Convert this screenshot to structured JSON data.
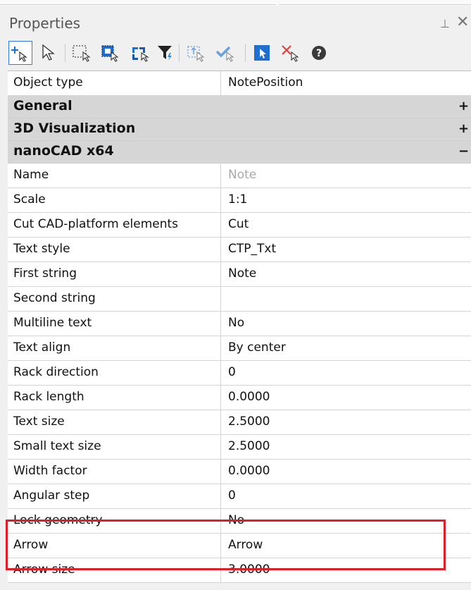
{
  "panel": {
    "title": "Properties",
    "pin_glyph": "⊥",
    "close_glyph": "✕"
  },
  "toolbar": {
    "icons": [
      "add-selection-icon",
      "select-cursor-icon",
      "window-select-icon",
      "quick-select-icon",
      "invert-select-icon",
      "filter-icon",
      "export-select-icon",
      "confirm-select-icon",
      "pick-object-icon",
      "deselect-icon",
      "help-icon"
    ]
  },
  "grid": {
    "object_type": {
      "name": "Object type",
      "value": "NotePosition"
    },
    "sections": [
      {
        "name": "General",
        "sign": "+"
      },
      {
        "name": "3D Visualization",
        "sign": "+"
      },
      {
        "name": "nanoCAD x64",
        "sign": "−"
      }
    ],
    "properties": [
      {
        "name": "Name",
        "value": "Note"
      },
      {
        "name": "Scale",
        "value": "1:1"
      },
      {
        "name": "Cut CAD-platform elements",
        "value": "Cut"
      },
      {
        "name": "Text style",
        "value": "CTP_Txt"
      },
      {
        "name": "First string",
        "value": "Note"
      },
      {
        "name": "Second string",
        "value": ""
      },
      {
        "name": "Multiline text",
        "value": "No"
      },
      {
        "name": "Text align",
        "value": "By center"
      },
      {
        "name": "Rack direction",
        "value": "0"
      },
      {
        "name": "Rack length",
        "value": "0.0000"
      },
      {
        "name": "Text size",
        "value": "2.5000"
      },
      {
        "name": "Small text size",
        "value": "2.5000"
      },
      {
        "name": "Width factor",
        "value": "0.0000"
      },
      {
        "name": "Angular step",
        "value": "0"
      },
      {
        "name": "Lock geometry",
        "value": "No"
      },
      {
        "name": "Arrow",
        "value": "Arrow"
      },
      {
        "name": "Arrow size",
        "value": "3.0000"
      }
    ]
  },
  "colors": {
    "highlight": "#e11d2a",
    "section_bg": "#d6d6d6",
    "accent": "#2a7de1"
  }
}
